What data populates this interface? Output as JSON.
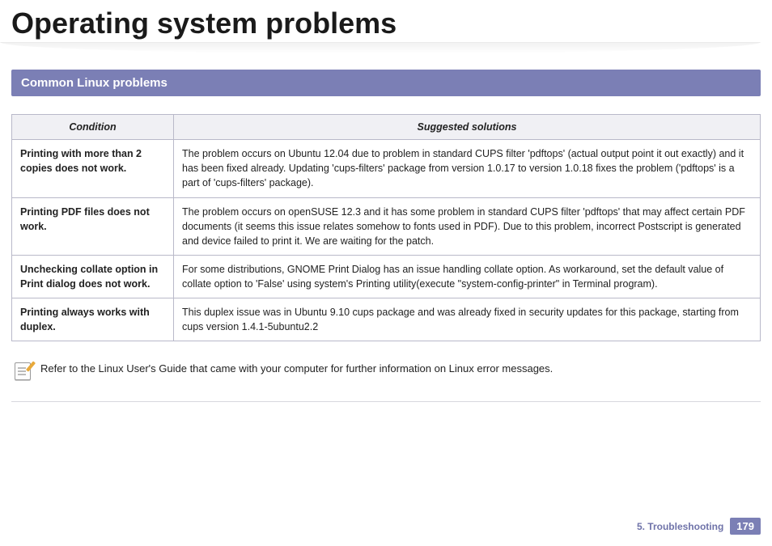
{
  "title": "Operating system problems",
  "section": "Common Linux problems",
  "headers": {
    "condition": "Condition",
    "solutions": "Suggested solutions"
  },
  "rows": [
    {
      "condition": "Printing with more than 2 copies does not work.",
      "solution": "The problem occurs on Ubuntu 12.04 due to problem in standard CUPS filter 'pdftops' (actual output point it out exactly) and it has been fixed already. Updating 'cups-filters' package from version 1.0.17 to version 1.0.18 fixes the problem ('pdftops' is a part of 'cups-filters' package)."
    },
    {
      "condition": "Printing PDF files does not work.",
      "solution": "The problem occurs on openSUSE 12.3 and it has some problem in standard CUPS filter 'pdftops' that may affect certain PDF documents (it seems this issue relates somehow to fonts used in PDF). Due to this problem, incorrect Postscript is generated and device failed to print it. We are waiting for the patch."
    },
    {
      "condition": "Unchecking collate option in Print dialog does not work.",
      "solution": "For some distributions, GNOME Print Dialog has an issue handling collate option. As workaround, set the default value of collate option to 'False' using system's Printing utility(execute \"system-config-printer\" in Terminal program)."
    },
    {
      "condition": "Printing always works with duplex.",
      "solution": "This duplex issue was in Ubuntu 9.10 cups package and was already fixed in security updates for this package, starting from cups version 1.4.1-5ubuntu2.2"
    }
  ],
  "note": "Refer to the Linux User's Guide that came with your computer for further information on Linux error messages.",
  "footer": {
    "chapter": "5.  Troubleshooting",
    "page": "179"
  }
}
